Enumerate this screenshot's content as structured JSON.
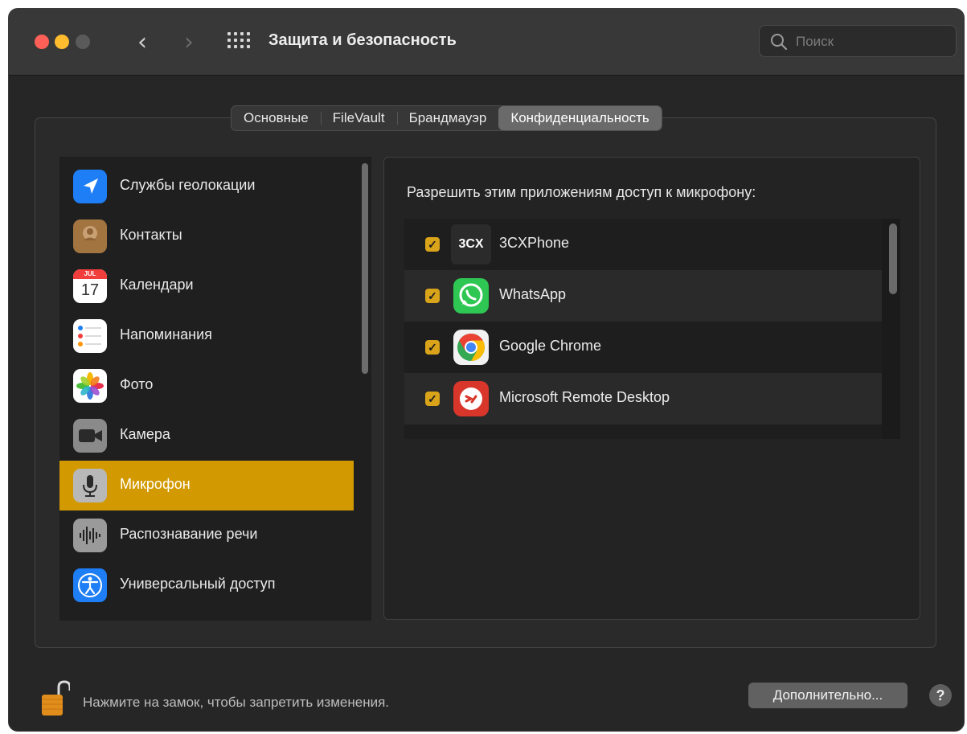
{
  "window": {
    "title": "Защита и безопасность",
    "search_placeholder": "Поиск"
  },
  "tabs": [
    {
      "label": "Основные"
    },
    {
      "label": "FileVault"
    },
    {
      "label": "Брандмауэр"
    },
    {
      "label": "Конфиденциальность",
      "active": true
    }
  ],
  "sidebar": {
    "items": [
      {
        "label": "Службы геолокации",
        "icon": "location-icon"
      },
      {
        "label": "Контакты",
        "icon": "contacts-icon"
      },
      {
        "label": "Календари",
        "icon": "calendar-icon",
        "icon_month": "JUL",
        "icon_day": "17"
      },
      {
        "label": "Напоминания",
        "icon": "reminders-icon"
      },
      {
        "label": "Фото",
        "icon": "photos-icon"
      },
      {
        "label": "Камера",
        "icon": "camera-icon"
      },
      {
        "label": "Микрофон",
        "icon": "microphone-icon",
        "selected": true
      },
      {
        "label": "Распознавание речи",
        "icon": "speech-recognition-icon"
      },
      {
        "label": "Универсальный доступ",
        "icon": "accessibility-icon"
      }
    ]
  },
  "main": {
    "heading": "Разрешить этим приложениям доступ к микрофону:",
    "apps": [
      {
        "name": "3CXPhone",
        "checked": true,
        "icon": "3cx-icon",
        "icon_text": "3CX"
      },
      {
        "name": "WhatsApp",
        "checked": true,
        "icon": "whatsapp-icon"
      },
      {
        "name": "Google Chrome",
        "checked": true,
        "icon": "chrome-icon"
      },
      {
        "name": "Microsoft Remote Desktop",
        "checked": true,
        "icon": "remote-desktop-icon"
      }
    ]
  },
  "footer": {
    "lock_text": "Нажмите на замок, чтобы запретить изменения.",
    "advanced_label": "Дополнительно...",
    "help_label": "?"
  },
  "colors": {
    "accent": "#d29a00",
    "checkbox": "#d9a31a",
    "window_bg": "#262626"
  }
}
